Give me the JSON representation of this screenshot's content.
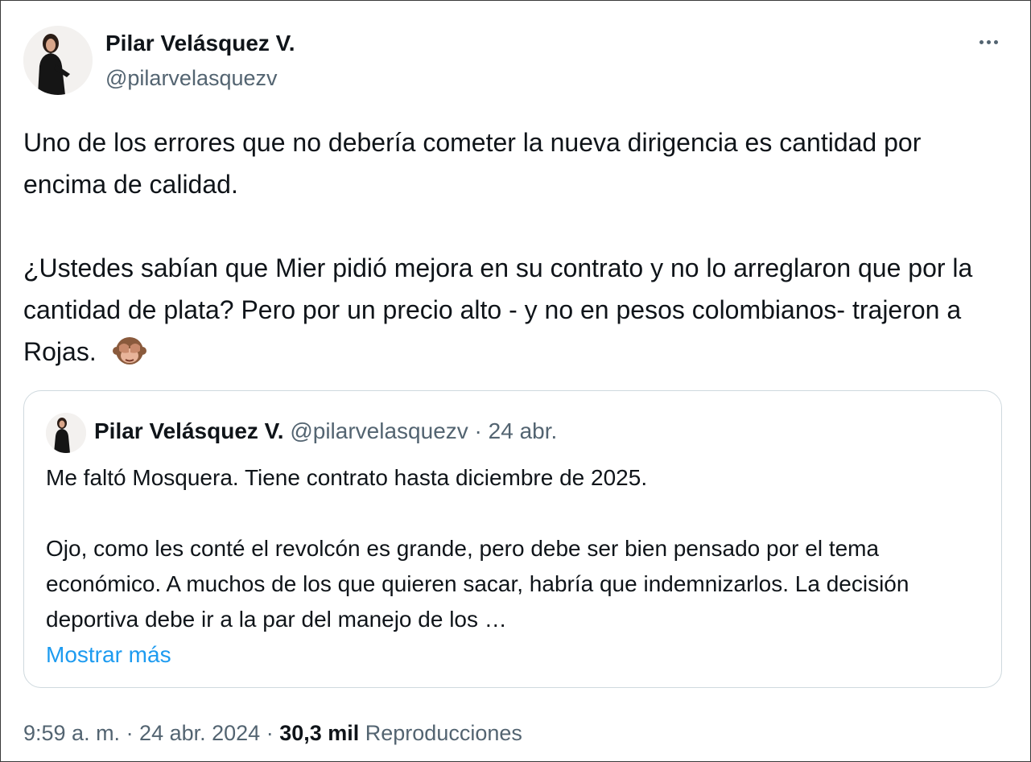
{
  "tweet": {
    "author_name": "Pilar Velásquez V.",
    "author_handle": "@pilarvelasquezv",
    "more_icon": "more-icon",
    "paragraph_1": "Uno de los errores que no debería cometer la nueva dirigencia es cantidad por encima de calidad.",
    "paragraph_2": "¿Ustedes sabían que Mier pidió mejora en su contrato y no lo arreglaron que por la cantidad de plata? Pero por un precio alto - y no en pesos colombianos- trajeron a Rojas.",
    "emoji": "see-no-evil-monkey-icon"
  },
  "quote": {
    "author_name": "Pilar Velásquez V.",
    "meta": "@pilarvelasquezv · 24 abr.",
    "paragraph_1": "Me faltó Mosquera. Tiene contrato hasta diciembre de 2025.",
    "paragraph_2": "Ojo, como les conté el revolcón es grande, pero debe ser bien pensado por el tema económico. A muchos de los que quieren sacar, habría que indemnizarlos. La decisión deportiva debe ir a la par del manejo de los …",
    "show_more": "Mostrar más"
  },
  "footer": {
    "time_date": "9:59 a. m. · 24 abr. 2024 · ",
    "views_count": "30,3 mil",
    "views_label": "Reproducciones"
  },
  "colors": {
    "text": "#0f1419",
    "secondary": "#536471",
    "link": "#1d9bf0",
    "border": "#cfd9de"
  }
}
